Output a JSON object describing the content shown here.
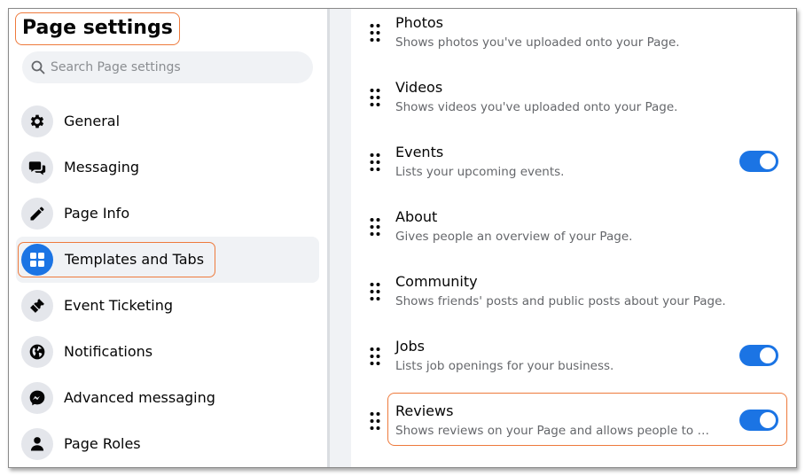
{
  "sidebar": {
    "title": "Page settings",
    "search_placeholder": "Search Page settings",
    "items": [
      {
        "label": "General",
        "icon": "gear-icon"
      },
      {
        "label": "Messaging",
        "icon": "chat-bubbles-icon"
      },
      {
        "label": "Page Info",
        "icon": "pencil-icon"
      },
      {
        "label": "Templates and Tabs",
        "icon": "grid-icon",
        "active": true
      },
      {
        "label": "Event Ticketing",
        "icon": "ticket-icon"
      },
      {
        "label": "Notifications",
        "icon": "globe-icon"
      },
      {
        "label": "Advanced messaging",
        "icon": "messenger-icon"
      },
      {
        "label": "Page Roles",
        "icon": "person-icon"
      }
    ]
  },
  "tabs": [
    {
      "title": "Photos",
      "description": "Shows photos you've uploaded onto your Page.",
      "toggle": null
    },
    {
      "title": "Videos",
      "description": "Shows videos you've uploaded onto your Page.",
      "toggle": null
    },
    {
      "title": "Events",
      "description": "Lists your upcoming events.",
      "toggle": "on"
    },
    {
      "title": "About",
      "description": "Gives people an overview of your Page.",
      "toggle": null
    },
    {
      "title": "Community",
      "description": "Shows friends' posts and public posts about your Page.",
      "toggle": null
    },
    {
      "title": "Jobs",
      "description": "Lists job openings for your business.",
      "toggle": "on"
    },
    {
      "title": "Reviews",
      "description": "Shows reviews on your Page and allows people to wr...",
      "toggle": "on"
    }
  ],
  "colors": {
    "accent": "#1b74e4",
    "highlight_outline": "#ee7a3c",
    "icon_bg": "#e4e6eb",
    "secondary_text": "#65676b"
  }
}
